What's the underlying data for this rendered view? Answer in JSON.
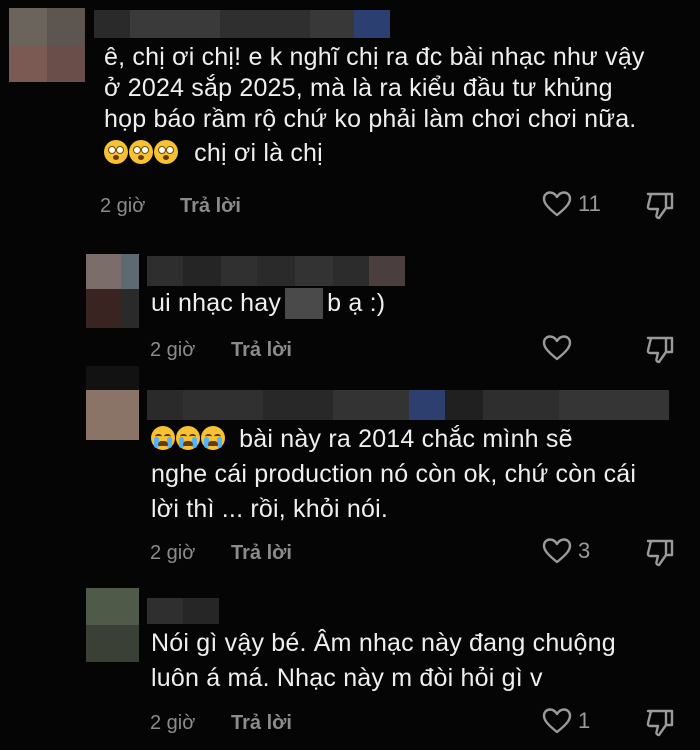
{
  "comments": [
    {
      "lines": [
        "ê, chị ơi chị! e k nghĩ chị ra đc bài nhạc như vậy",
        "ở 2024 sắp 2025, mà là ra kiểu đầu tư khủng",
        "họp báo rầm rộ chứ ko phải làm chơi chơi nữa."
      ],
      "emoji_line_text": "chị ơi là chị",
      "emoji": "flushed-face",
      "time": "2 giờ",
      "reply_label": "Trả lời",
      "like_count": "11"
    },
    {
      "text_before": "ui nhạc hay",
      "text_after": "b ạ :)",
      "time": "2 giờ",
      "reply_label": "Trả lời",
      "like_count": ""
    },
    {
      "first_line_text": "bài này ra 2014 chắc mình sẽ",
      "lines": [
        "nghe cái production nó còn ok, chứ còn cái",
        "lời thì ... rồi, khỏi nói."
      ],
      "emoji": "loudly-crying-face",
      "time": "2 giờ",
      "reply_label": "Trả lời",
      "like_count": "3"
    },
    {
      "lines": [
        "Nói gì vậy bé. Âm nhạc này đang chuộng",
        "luôn á má. Nhạc này m đòi hỏi gì v"
      ],
      "time": "2 giờ",
      "reply_label": "Trả lời",
      "like_count": "1"
    }
  ],
  "icons": {
    "like": "heart-outline-icon",
    "dislike": "thumbs-down-outline-icon"
  },
  "colors": {
    "background": "#050505",
    "text": "#efefef",
    "meta": "#8b8b8b"
  }
}
